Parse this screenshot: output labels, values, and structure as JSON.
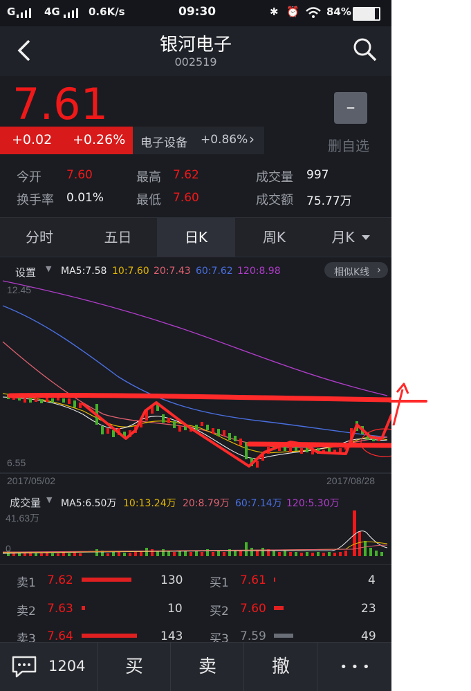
{
  "status_bar": {
    "carrier": "G",
    "network": "4G",
    "speed": "0.6K/s",
    "time": "09:30",
    "battery": "84%"
  },
  "header": {
    "title": "银河电子",
    "code": "002519",
    "back_icon": "chevron-left-icon",
    "search_icon": "search-icon"
  },
  "quote": {
    "price": "7.61",
    "change": "+0.02",
    "change_pct": "+0.26%",
    "sector_name": "电子设备",
    "sector_change": "+0.86%",
    "watchlist_button": "–",
    "watchlist_label": "删自选",
    "stats": [
      {
        "label": "今开",
        "value": "7.60"
      },
      {
        "label": "最高",
        "value": "7.62"
      },
      {
        "label": "成交量",
        "value": "997"
      },
      {
        "label": "换手率",
        "value": "0.01%"
      },
      {
        "label": "最低",
        "value": "7.60"
      },
      {
        "label": "成交额",
        "value": "75.77万"
      }
    ]
  },
  "tabs": [
    "分时",
    "五日",
    "日K",
    "周K",
    "月K"
  ],
  "active_tab": "日K",
  "kline": {
    "settings_label": "设置",
    "ma5": "MA5:7.58",
    "ma10": "10:7.60",
    "ma20": "20:7.43",
    "ma60": "60:7.62",
    "ma120": "120:8.98",
    "similar_button": "相似K线",
    "price_high": "12.45",
    "price_low": "6.55",
    "date_start": "2017/05/02",
    "date_end": "2017/08/28"
  },
  "volume": {
    "label": "成交量",
    "ma5": "MA5:6.50万",
    "ma10": "10:13.24万",
    "ma20": "20:8.79万",
    "ma60": "60:7.14万",
    "ma120": "120:5.30万",
    "max": "41.63万",
    "min": "0"
  },
  "orderbook": {
    "sell": [
      {
        "label": "卖1",
        "price": "7.62",
        "qty": "130"
      },
      {
        "label": "卖2",
        "price": "7.63",
        "qty": "10"
      },
      {
        "label": "卖3",
        "price": "7.64",
        "qty": "143"
      }
    ],
    "buy": [
      {
        "label": "买1",
        "price": "7.61",
        "qty": "4"
      },
      {
        "label": "买2",
        "price": "7.60",
        "qty": "23"
      },
      {
        "label": "买3",
        "price": "7.59",
        "qty": "49"
      }
    ]
  },
  "bottom_bar": {
    "comment_count": "1204",
    "buy": "买",
    "sell": "卖",
    "cancel": "撤",
    "more": "• • •"
  },
  "colors": {
    "up": "#f01818",
    "down": "#44b02a",
    "ma5": "#e8e8e8",
    "ma10": "#e6b800",
    "ma20": "#e0606e",
    "ma60": "#4a6fe0",
    "ma120": "#b03cc8"
  }
}
